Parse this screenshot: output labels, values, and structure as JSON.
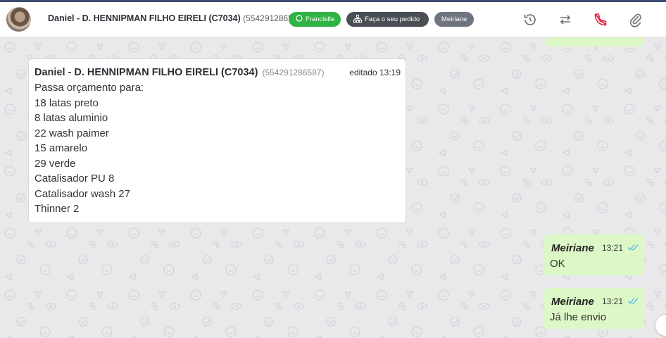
{
  "header": {
    "contact_name": "Daniel - D. HENNIPMAN FILHO EIRELI (C7034)",
    "contact_phone": "(554291286587)",
    "chip_whatsapp": "Francielle",
    "chip_order": "Faça o seu pedido",
    "chip_agent": "Meiriane",
    "icons": [
      "history-icon",
      "transfer-icon",
      "end-call-icon",
      "attachment-icon"
    ],
    "colors": {
      "whatsapp": "#2fb344",
      "end_call": "#e0233a"
    }
  },
  "incoming": {
    "sender": "Daniel - D. HENNIPMAN FILHO EIRELI (C7034)",
    "phone": "(554291286587)",
    "edited": "editado 13:19",
    "lines": [
      "Passa orçamento para:",
      "18 latas preto",
      "8 latas aluminio",
      "22 wash paimer",
      "15 amarelo",
      "29 verde",
      "Catalisador PU 8",
      "Catalisador wash 27",
      "Thinner 2"
    ]
  },
  "outgoing": [
    {
      "sender": "Meiriane",
      "time": "13:21",
      "text": "OK"
    },
    {
      "sender": "Meiriane",
      "time": "13:21",
      "text": "Já lhe envio"
    }
  ]
}
